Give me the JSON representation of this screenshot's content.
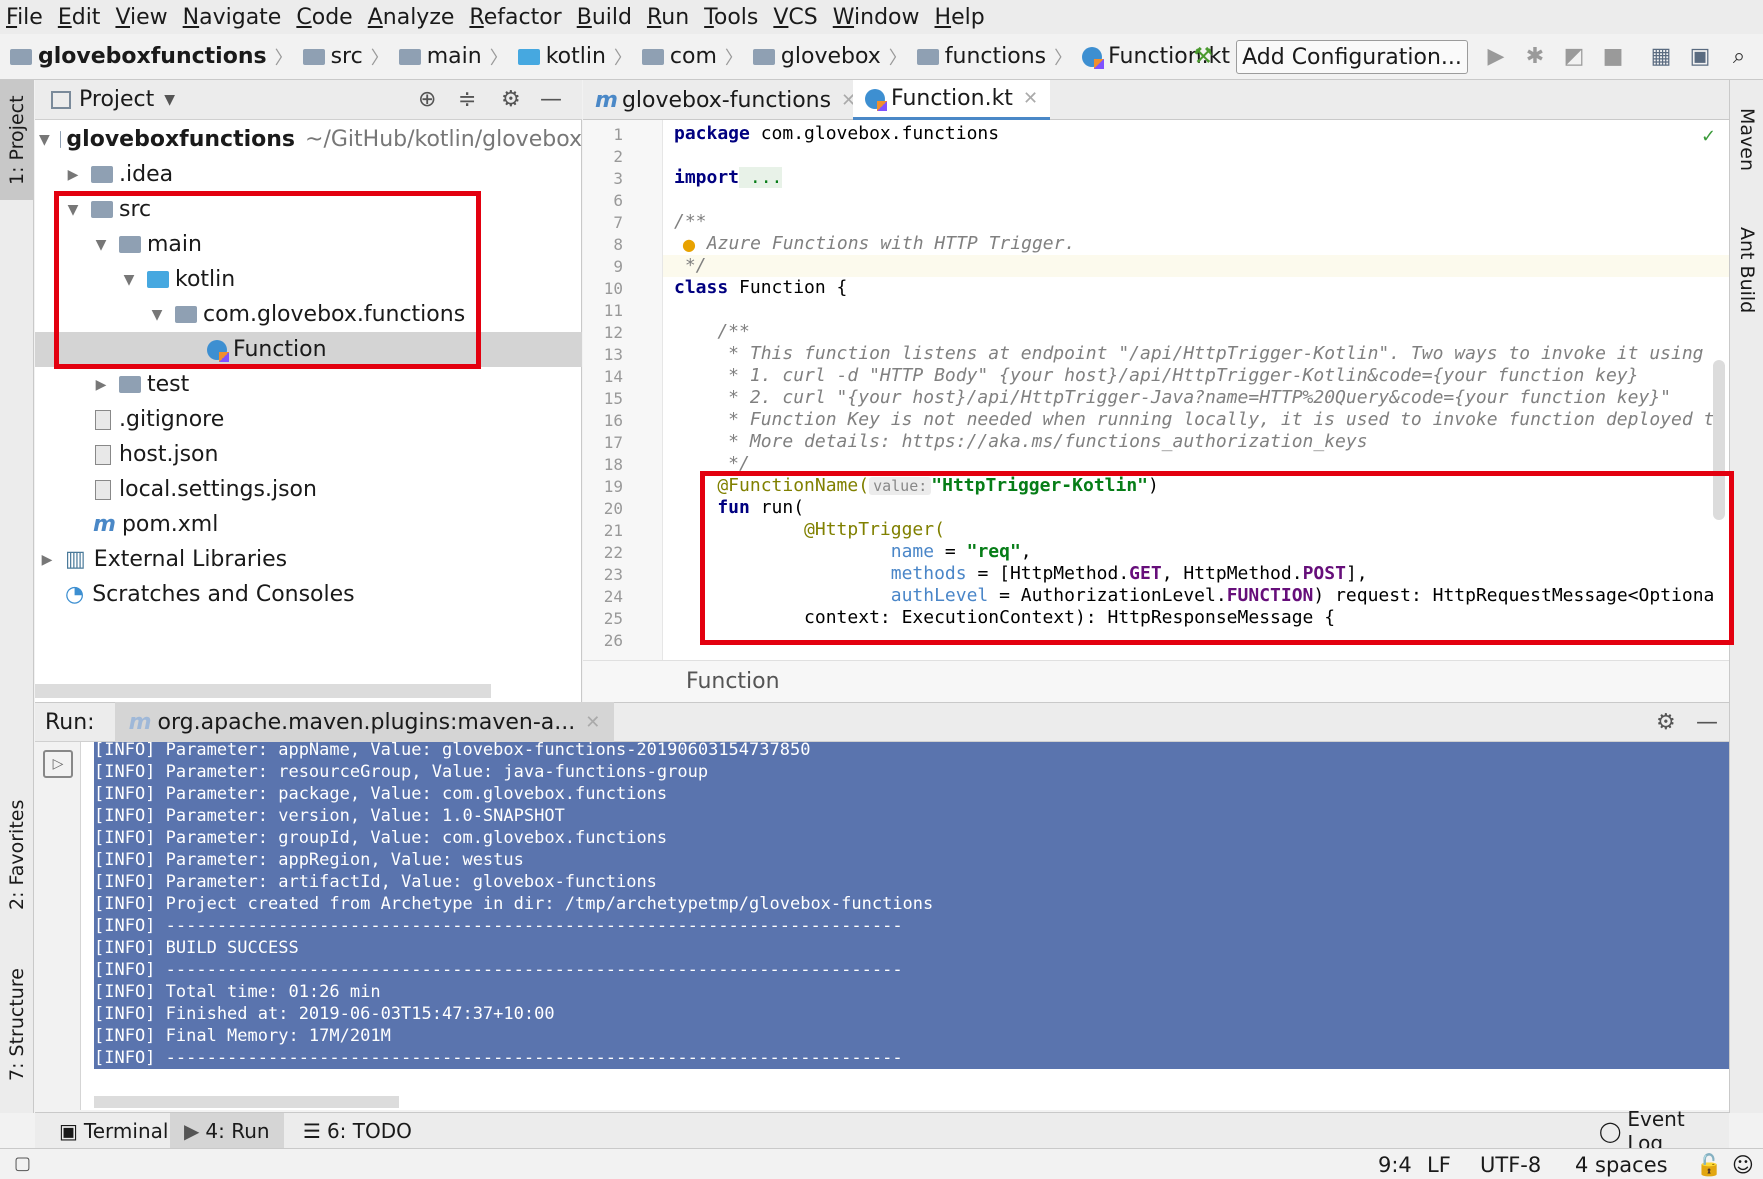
{
  "menu": [
    "File",
    "Edit",
    "View",
    "Navigate",
    "Code",
    "Analyze",
    "Refactor",
    "Build",
    "Run",
    "Tools",
    "VCS",
    "Window",
    "Help"
  ],
  "breadcrumbs": [
    "gloveboxfunctions",
    "src",
    "main",
    "kotlin",
    "com",
    "glovebox",
    "functions",
    "Function.kt"
  ],
  "toolbar": {
    "add_configuration": "Add Configuration..."
  },
  "side_tabs": {
    "project": "1: Project",
    "favorites": "2: Favorites",
    "structure": "7: Structure",
    "maven": "Maven",
    "ant": "Ant Build"
  },
  "project_panel": {
    "title": "Project",
    "tree": [
      {
        "label": "gloveboxfunctions",
        "extra": "~/GitHub/kotlin/glovebox"
      },
      {
        "label": ".idea"
      },
      {
        "label": "src"
      },
      {
        "label": "main"
      },
      {
        "label": "kotlin"
      },
      {
        "label": "com.glovebox.functions"
      },
      {
        "label": "Function"
      },
      {
        "label": "test"
      },
      {
        "label": ".gitignore"
      },
      {
        "label": "host.json"
      },
      {
        "label": "local.settings.json"
      },
      {
        "label": "pom.xml"
      },
      {
        "label": "External Libraries"
      },
      {
        "label": "Scratches and Consoles"
      }
    ]
  },
  "editor_tabs": [
    "glovebox-functions",
    "Function.kt"
  ],
  "editor": {
    "line_numbers": [
      "1",
      "2",
      "3",
      "6",
      "7",
      "8",
      "9",
      "10",
      "11",
      "12",
      "13",
      "14",
      "15",
      "16",
      "17",
      "18",
      "19",
      "20",
      "21",
      "22",
      "23",
      "24",
      "25",
      "26"
    ],
    "lines": {
      "l1_kw": "package",
      "l1_rest": " com.glovebox.functions",
      "l3_kw": "import",
      "l3_rest": " ...",
      "l7": "/**",
      "l8": " Azure Functions with HTTP Trigger.",
      "l9": " */",
      "l10_kw": "class",
      "l10_rest": " Function {",
      "l12": "    /**",
      "l13": "     * This function listens at endpoint \"/api/HttpTrigger-Kotlin\". Two ways to invoke it using",
      "l14": "     * 1. curl -d \"HTTP Body\" {your host}/api/HttpTrigger-Kotlin&code={your function key}",
      "l15": "     * 2. curl \"{your host}/api/HttpTrigger-Java?name=HTTP%20Query&code={your function key}\"",
      "l16": "     * Function Key is not needed when running locally, it is used to invoke function deployed t",
      "l17": "     * More details: https://aka.ms/functions_authorization_keys",
      "l18": "     */",
      "l19_ann": "    @FunctionName(",
      "l19_hint": "value:",
      "l19_str": "\"HttpTrigger-Kotlin\"",
      "l19_end": ")",
      "l20_kw": "    fun",
      "l20_rest": " run(",
      "l21": "            @HttpTrigger(",
      "l22_p": "                    name",
      "l22_eq": " = ",
      "l22_str": "\"req\"",
      "l22_end": ",",
      "l23_p": "                    methods",
      "l23_eq": " = [HttpMethod.",
      "l23_e1": "GET",
      "l23_mid": ", HttpMethod.",
      "l23_e2": "POST",
      "l23_end": "],",
      "l24_p": "                    authLevel",
      "l24_eq": " = AuthorizationLevel.",
      "l24_e": "FUNCTION",
      "l24_end": ") request: HttpRequestMessage<Optiona",
      "l25": "            context: ExecutionContext): HttpResponseMessage {"
    },
    "breadcrumb": "Function"
  },
  "run_panel": {
    "label": "Run:",
    "tab": "org.apache.maven.plugins:maven-a...",
    "console": [
      "[INFO] Parameter: appName, Value: glovebox-functions-20190603154737850",
      "[INFO] Parameter: resourceGroup, Value: java-functions-group",
      "[INFO] Parameter: package, Value: com.glovebox.functions",
      "[INFO] Parameter: version, Value: 1.0-SNAPSHOT",
      "[INFO] Parameter: groupId, Value: com.glovebox.functions",
      "[INFO] Parameter: appRegion, Value: westus",
      "[INFO] Parameter: artifactId, Value: glovebox-functions",
      "[INFO] Project created from Archetype in dir: /tmp/archetypetmp/glovebox-functions",
      "[INFO] ------------------------------------------------------------------------",
      "[INFO] BUILD SUCCESS",
      "[INFO] ------------------------------------------------------------------------",
      "[INFO] Total time: 01:26 min",
      "[INFO] Finished at: 2019-06-03T15:47:37+10:00",
      "[INFO] Final Memory: 17M/201M",
      "[INFO] ------------------------------------------------------------------------"
    ]
  },
  "bottom_tabs": {
    "terminal": "Terminal",
    "run": "4: Run",
    "todo": "6: TODO",
    "event_log": "Event Log"
  },
  "status": {
    "position": "9:4",
    "line_sep": "LF",
    "encoding": "UTF-8",
    "indent": "4 spaces"
  },
  "colors": {
    "highlight_box": "#e3000f",
    "console_selection": "#5a74ae"
  }
}
